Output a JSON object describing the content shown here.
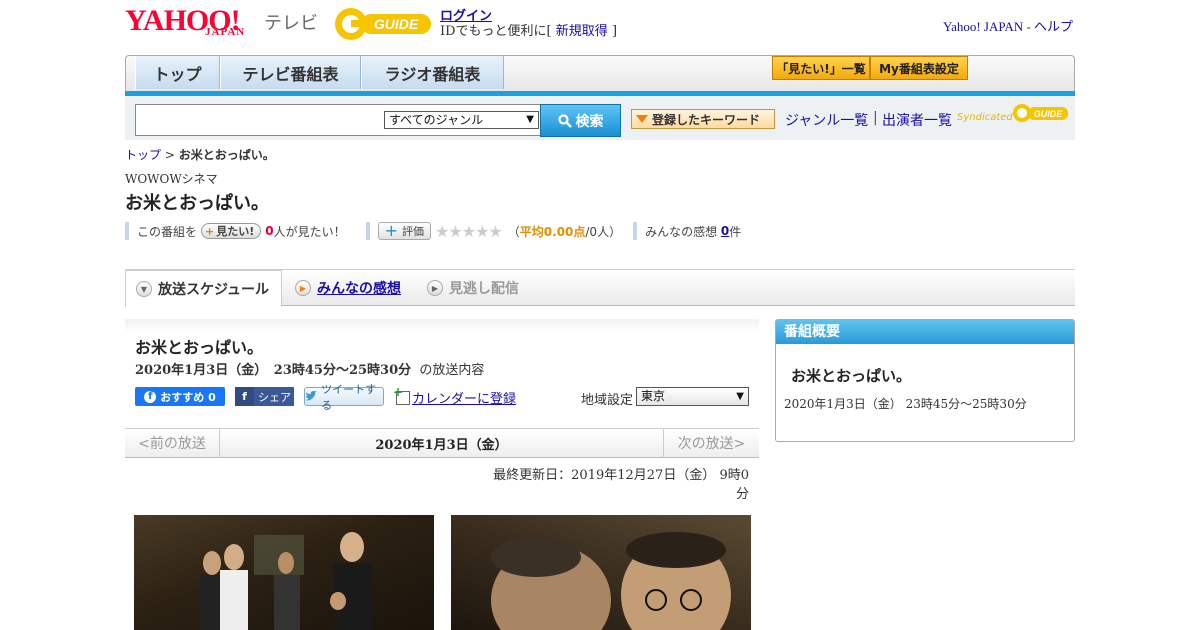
{
  "header": {
    "logo_yahoo": "YAHOO!",
    "logo_japan": "JAPAN",
    "logo_tv": "テレビ",
    "gguide_logo": "G GUIDE",
    "login": "ログイン",
    "login_sub_prefix": "IDでもっと便利に[",
    "register": "新規取得",
    "login_sub_suffix": "]",
    "yahoo_japan_link": "Yahoo! JAPAN",
    "sep": " - ",
    "help": "ヘルプ"
  },
  "nav": {
    "tabs": [
      {
        "label": "トップ"
      },
      {
        "label": "テレビ番組表"
      },
      {
        "label": "ラジオ番組表"
      }
    ],
    "mitai_list": "「見たい!」一覧",
    "my_bangumi": "My番組表設定"
  },
  "search": {
    "placeholder": "",
    "genre_selected": "すべてのジャンル",
    "search_button": "検索",
    "keyword_button": "登録したキーワード",
    "genre_list": "ジャンル一覧",
    "divider": "|",
    "actor_list": "出演者一覧",
    "syndicated": "Syndicated",
    "syn_logo": "G GUIDE"
  },
  "breadcrumb": {
    "home": "トップ",
    "sep": " > ",
    "current": "お米とおっぱい。"
  },
  "program": {
    "channel": "WOWOWシネマ",
    "title": "お米とおっぱい。",
    "prefix": "この番組を",
    "mitai_btn": "見たい!",
    "mitai_count": "0",
    "mitai_suffix": "人が見たい！",
    "hyoka_btn": "評価",
    "stars": "★★★★★",
    "avg_prefix": "（",
    "avg_value": "平均0.00点",
    "avg_suffix": "/0人）",
    "kanso_label": "みんなの感想",
    "kanso_count": "0",
    "kanso_unit": "件"
  },
  "tabs": [
    {
      "label": "放送スケジュール"
    },
    {
      "label": "みんなの感想"
    },
    {
      "label": "見逃し配信"
    }
  ],
  "broadcast": {
    "title": "お米とおっぱい。",
    "datetime": "2020年1月3日（金）　23時45分～25時30分",
    "suffix": "の放送内容",
    "fb_label": "おすすめ 0",
    "share_label": "シェア",
    "tweet_label": "ツイートする",
    "calendar": "カレンダーに登録",
    "region_label": "地域設定",
    "region_value": "東京",
    "prev": "<前の放送",
    "date": "2020年1月3日（金）",
    "next": "次の放送>",
    "updated": "最終更新日：2019年12月27日（金）  9時0分"
  },
  "side": {
    "heading": "番組概要",
    "title": "お米とおっぱい。",
    "time": "2020年1月3日（金）  23時45分～25時30分"
  },
  "colors": {
    "accent_blue": "#1ea0e0",
    "yahoo_red": "#ff0033",
    "orange": "#f4a90a",
    "link": "#1a0dab"
  }
}
